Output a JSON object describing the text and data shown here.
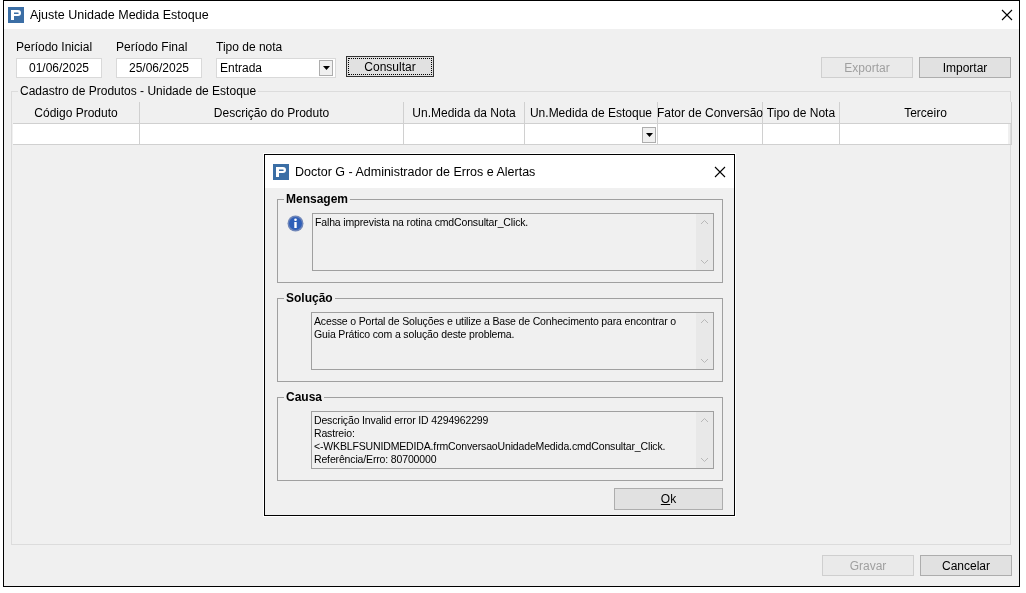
{
  "window": {
    "title": "Ajuste Unidade Medida Estoque"
  },
  "filters": [
    {
      "kind": "text",
      "label": "Período Inicial",
      "value": "01/06/2025"
    },
    {
      "kind": "text",
      "label": "Período Final",
      "value": "25/06/2025"
    },
    {
      "kind": "dropdown",
      "label": "Tipo de nota",
      "value": "Entrada"
    }
  ],
  "consultar_button": {
    "label": "Consultar",
    "focused": true
  },
  "toolbar_buttons": [
    {
      "label": "Exportar",
      "disabled": true
    },
    {
      "label": "Importar",
      "disabled": false
    }
  ],
  "group": {
    "title": "Cadastro de Produtos - Unidade de Estoque",
    "columns": [
      {
        "label": "Código Produto",
        "kind": "text"
      },
      {
        "label": "Descrição do Produto",
        "kind": "text"
      },
      {
        "label": "Un.Medida da Nota",
        "kind": "text"
      },
      {
        "label": "Un.Medida de Estoque",
        "kind": "dropdown"
      },
      {
        "label": "Fator de Conversão",
        "kind": "text"
      },
      {
        "label": "Tipo de Nota",
        "kind": "text"
      },
      {
        "label": "Terceiro",
        "kind": "text"
      }
    ]
  },
  "footer_buttons": [
    {
      "label": "Gravar",
      "disabled": true
    },
    {
      "label": "Cancelar",
      "disabled": false
    }
  ],
  "dialog": {
    "title": "Doctor G - Administrador de Erros e Alertas",
    "sections": [
      {
        "title": "Mensagem",
        "kind": "info",
        "lines": [
          "Falha imprevista na rotina cmdConsultar_Click."
        ]
      },
      {
        "title": "Solução",
        "lines": [
          "Acesse o Portal de Soluções e utilize a Base de Conhecimento para encontrar o",
          "Guia Prático com a solução deste problema."
        ]
      },
      {
        "title": "Causa",
        "lines": [
          "Descrição Invalid error ID 4294962299",
          "Rastreio:",
          "<-WKBLFSUNIDMEDIDA.frmConversaoUnidadeMedida.cmdConsultar_Click.",
          "Referência/Erro: 80700000"
        ]
      }
    ],
    "button": "Ok"
  }
}
